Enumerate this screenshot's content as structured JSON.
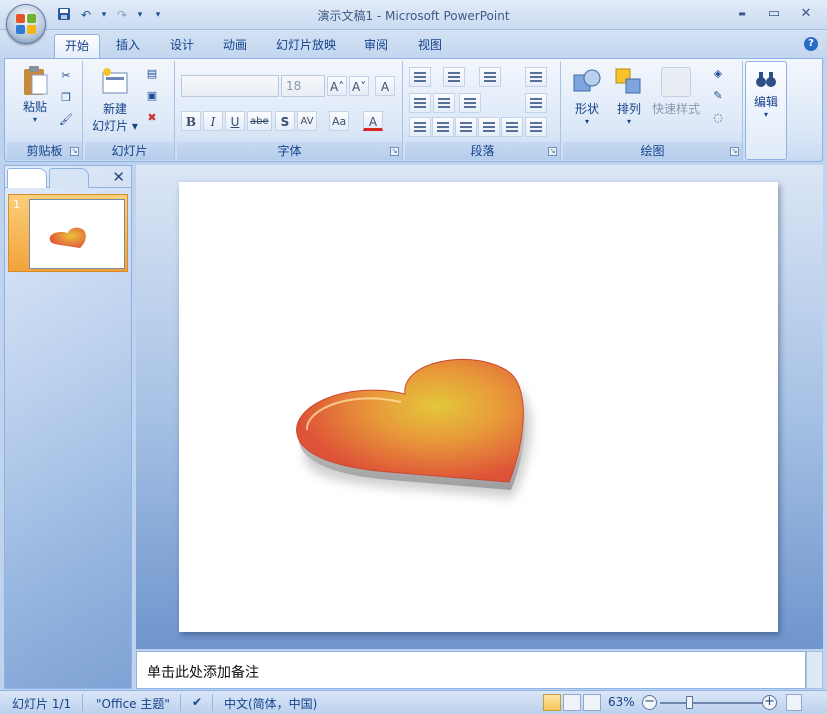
{
  "window": {
    "title": "演示文稿1 - Microsoft PowerPoint",
    "minimize": "▬",
    "maximize": "▭",
    "close": "✕"
  },
  "qat": {
    "undo": "↶",
    "redo": "↷",
    "dropdown": "▾"
  },
  "tabs": [
    {
      "label": "开始",
      "active": true
    },
    {
      "label": "插入"
    },
    {
      "label": "设计"
    },
    {
      "label": "动画"
    },
    {
      "label": "幻灯片放映"
    },
    {
      "label": "审阅"
    },
    {
      "label": "视图"
    }
  ],
  "help": "?",
  "ribbon": {
    "clipboard": {
      "label": "剪贴板",
      "paste": "粘贴"
    },
    "slides": {
      "label": "幻灯片",
      "new_slide_line1": "新建",
      "new_slide_line2": "幻灯片 ▾"
    },
    "font": {
      "label": "字体",
      "font_size": "18",
      "grow": "A˄",
      "shrink": "A˅",
      "clear": "A",
      "bold": "B",
      "italic": "I",
      "underline": "U",
      "strike": "abe",
      "shadow": "S",
      "spacing": "AV",
      "case": "Aa",
      "color": "A"
    },
    "paragraph": {
      "label": "段落"
    },
    "drawing": {
      "label": "绘图",
      "shapes": "形状",
      "arrange": "排列",
      "quick_styles": "快速样式"
    },
    "editing": {
      "label": "编辑"
    }
  },
  "left_panel": {
    "slide_number": "1",
    "close": "✕"
  },
  "notes": {
    "placeholder": "单击此处添加备注"
  },
  "status": {
    "slide": "幻灯片 1/1",
    "theme": "\"Office 主题\"",
    "language": "中文(简体，中国)",
    "zoom": "63%",
    "zoom_out": "−",
    "zoom_in": "+"
  },
  "colors": {
    "heart_outer": "#e25a3a",
    "heart_inner": "#e9c53b",
    "accent": "#15428b"
  }
}
